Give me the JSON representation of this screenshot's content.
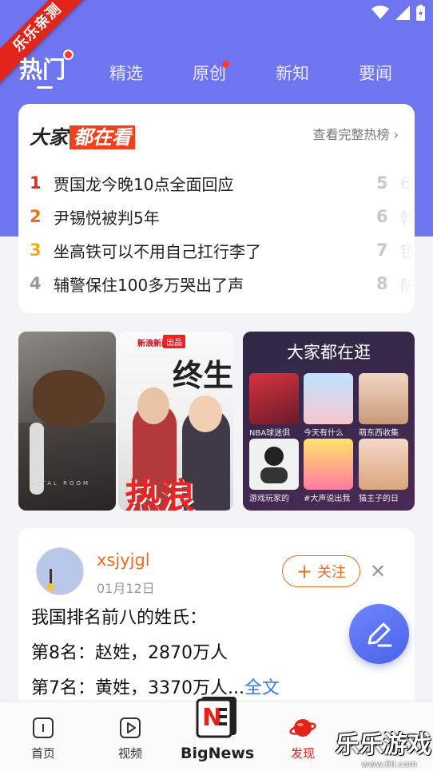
{
  "ribbon": "乐乐亲测",
  "tabs": [
    {
      "label": "热门",
      "active": true
    },
    {
      "label": "精选"
    },
    {
      "label": "原创",
      "dot": true
    },
    {
      "label": "新知"
    },
    {
      "label": "要闻"
    }
  ],
  "hot": {
    "title_a": "大家",
    "title_b": "都在看",
    "more": "查看完整热榜",
    "items": [
      {
        "rank": "1",
        "text": "贾国龙今晚10点全面回应",
        "color": "#e62b1c"
      },
      {
        "rank": "2",
        "text": "尹锡悦被判5年",
        "color": "#f26a1b"
      },
      {
        "rank": "3",
        "text": "坐高铁可以不用自己扛行李了",
        "color": "#f5a623"
      },
      {
        "rank": "4",
        "text": "辅警保住100多万哭出了声",
        "color": "#999999"
      }
    ],
    "items_right": [
      {
        "rank": "5",
        "text": "6"
      },
      {
        "rank": "6",
        "text": "韩"
      },
      {
        "rank": "7",
        "text": "银"
      },
      {
        "rank": "8",
        "text": "防"
      }
    ]
  },
  "banners": {
    "b1_text": "GITAL ROOM",
    "b2_logo": "新浪新闻",
    "b2_badge": "出品",
    "b2_big": "终生理",
    "b2_hot": "热浪",
    "b3_title": "大家都在逛",
    "tiles": [
      {
        "caption": "NBA球迷俱"
      },
      {
        "caption": "今天有什么"
      },
      {
        "caption": "萌东西收集"
      },
      {
        "caption": "游戏玩家的"
      },
      {
        "caption": "#大声说出我"
      },
      {
        "caption": "猫主子的日"
      }
    ]
  },
  "post": {
    "username": "xsjyjgl",
    "date": "01月12日",
    "follow": "关注",
    "lines": [
      "我国排名前八的姓氏：",
      "第8名：赵姓，2870万人",
      "第7名：黄姓，3370万人..."
    ],
    "more": "全文"
  },
  "nav": {
    "home": "首页",
    "video": "视频",
    "bignews": "BigNews",
    "discover": "发现",
    "watermark": "乐乐游戏",
    "watermark_sub": "www.6ll.com"
  }
}
